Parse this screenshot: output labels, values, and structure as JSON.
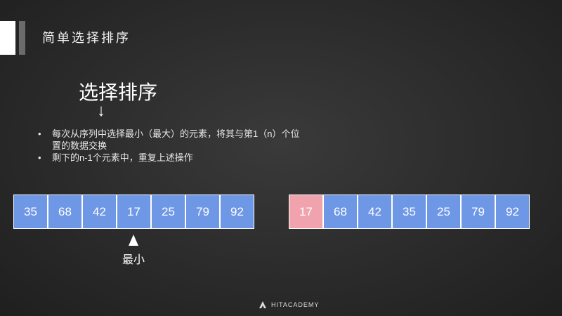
{
  "header": {
    "title": "简单选择排序"
  },
  "main": {
    "heading": "选择排序",
    "arrow": "↓",
    "bullets": [
      {
        "dot": "•",
        "text": "每次从序列中选择最小（最大）的元素，将其与第1（n）个位置的数据交换"
      },
      {
        "dot": "•",
        "text": "剩下的n-1个元素中，重复上述操作"
      }
    ]
  },
  "arrays": {
    "before": [
      "35",
      "68",
      "42",
      "17",
      "25",
      "79",
      "92"
    ],
    "after": [
      "17",
      "68",
      "42",
      "35",
      "25",
      "79",
      "92"
    ],
    "min_label": "最小"
  },
  "colors": {
    "cell": "#6e97e6",
    "highlight": "#f0a3ad"
  },
  "logo": {
    "text": "HITACADEMY"
  }
}
